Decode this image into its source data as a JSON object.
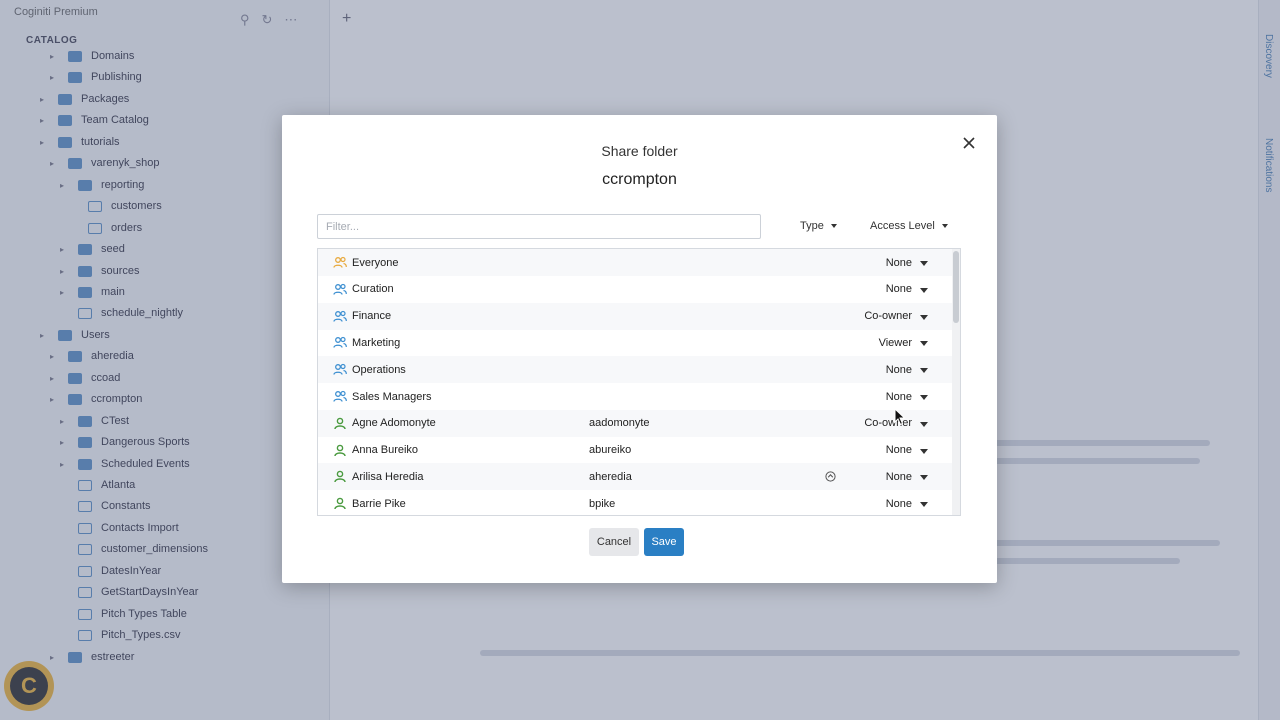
{
  "app": {
    "title": "Coginiti Premium",
    "catalog_label": "CATALOG",
    "side_tabs": [
      "Discovery",
      "Notifications"
    ],
    "tree": [
      {
        "label": "Domains",
        "type": "folder",
        "depth": 2
      },
      {
        "label": "Publishing",
        "type": "folder",
        "depth": 2
      },
      {
        "label": "Packages",
        "type": "folder",
        "depth": 1
      },
      {
        "label": "Team Catalog",
        "type": "folder",
        "depth": 1
      },
      {
        "label": "tutorials",
        "type": "folder",
        "depth": 1
      },
      {
        "label": "varenyk_shop",
        "type": "folder",
        "depth": 2
      },
      {
        "label": "reporting",
        "type": "folder",
        "depth": 3
      },
      {
        "label": "customers",
        "type": "file",
        "depth": 4
      },
      {
        "label": "orders",
        "type": "file",
        "depth": 4
      },
      {
        "label": "seed",
        "type": "folder",
        "depth": 3
      },
      {
        "label": "sources",
        "type": "folder",
        "depth": 3
      },
      {
        "label": "main",
        "type": "folder",
        "depth": 3
      },
      {
        "label": "schedule_nightly",
        "type": "file",
        "depth": 3
      },
      {
        "label": "Users",
        "type": "folder",
        "depth": 1
      },
      {
        "label": "aheredia",
        "type": "folder",
        "depth": 2
      },
      {
        "label": "ccoad",
        "type": "folder",
        "depth": 2
      },
      {
        "label": "ccrompton",
        "type": "folder",
        "depth": 2
      },
      {
        "label": "CTest",
        "type": "folder",
        "depth": 3
      },
      {
        "label": "Dangerous Sports",
        "type": "folder",
        "depth": 3
      },
      {
        "label": "Scheduled Events",
        "type": "folder",
        "depth": 3
      },
      {
        "label": "Atlanta",
        "type": "file",
        "depth": 3
      },
      {
        "label": "Constants",
        "type": "file",
        "depth": 3
      },
      {
        "label": "Contacts Import",
        "type": "file",
        "depth": 3
      },
      {
        "label": "customer_dimensions",
        "type": "file",
        "depth": 3
      },
      {
        "label": "DatesInYear",
        "type": "file",
        "depth": 3
      },
      {
        "label": "GetStartDaysInYear",
        "type": "file",
        "depth": 3
      },
      {
        "label": "Pitch Types Table",
        "type": "file",
        "depth": 3
      },
      {
        "label": "Pitch_Types.csv",
        "type": "file",
        "depth": 3
      },
      {
        "label": "estreeter",
        "type": "folder",
        "depth": 2
      }
    ]
  },
  "dialog": {
    "title": "Share folder",
    "subtitle": "ccrompton",
    "filter_placeholder": "Filter...",
    "type_label": "Type",
    "access_label": "Access Level",
    "rows": [
      {
        "name": "Everyone",
        "username": "",
        "access": "None",
        "kind": "group-everyone",
        "badge": false
      },
      {
        "name": "Curation",
        "username": "",
        "access": "None",
        "kind": "group",
        "badge": false
      },
      {
        "name": "Finance",
        "username": "",
        "access": "Co-owner",
        "kind": "group",
        "badge": false
      },
      {
        "name": "Marketing",
        "username": "",
        "access": "Viewer",
        "kind": "group",
        "badge": false
      },
      {
        "name": "Operations",
        "username": "",
        "access": "None",
        "kind": "group",
        "badge": false
      },
      {
        "name": "Sales Managers",
        "username": "",
        "access": "None",
        "kind": "group",
        "badge": false
      },
      {
        "name": "Agne Adomonyte",
        "username": "aadomonyte",
        "access": "Co-owner",
        "kind": "user",
        "badge": false
      },
      {
        "name": "Anna Bureiko",
        "username": "abureiko",
        "access": "None",
        "kind": "user",
        "badge": false
      },
      {
        "name": "Arilisa Heredia",
        "username": "aheredia",
        "access": "None",
        "kind": "user",
        "badge": true
      },
      {
        "name": "Barrie Pike",
        "username": "bpike",
        "access": "None",
        "kind": "user",
        "badge": false
      }
    ],
    "cancel_label": "Cancel",
    "save_label": "Save"
  },
  "colors": {
    "accent": "#2a7fc4",
    "group_icon": "#3d8fd1",
    "everyone_icon": "#e8a93d",
    "user_icon": "#4a9a3f"
  }
}
